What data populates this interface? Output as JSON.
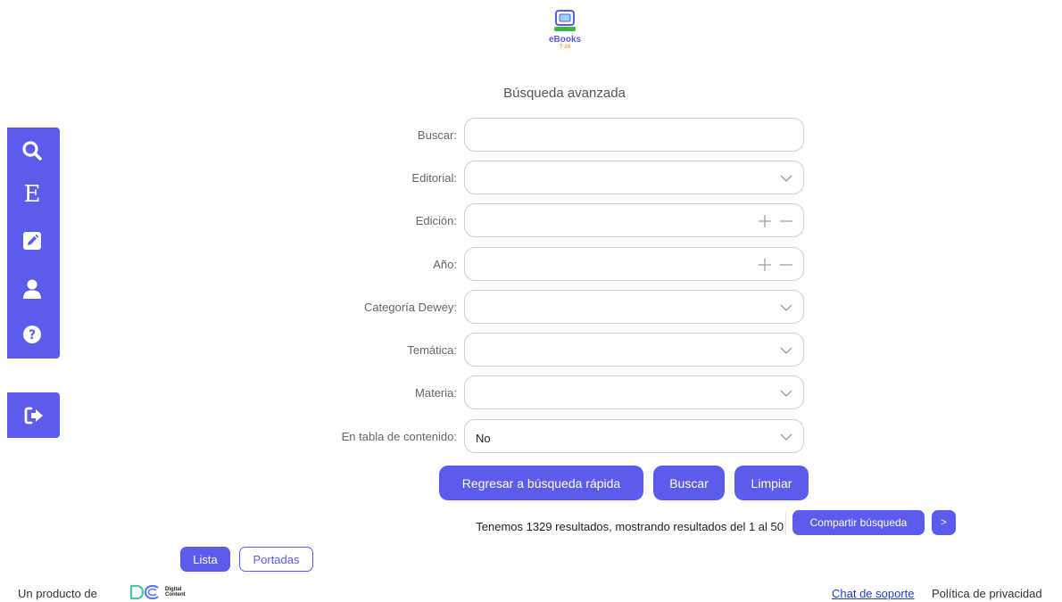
{
  "logo": {
    "text": "eBooks",
    "sub": "7·24"
  },
  "page_title": "Búsqueda avanzada",
  "sidebar": [
    {
      "icon": "search-icon"
    },
    {
      "icon": "editorial-icon",
      "glyph": "E"
    },
    {
      "icon": "pencil-icon"
    },
    {
      "icon": "user-icon"
    },
    {
      "icon": "help-icon"
    }
  ],
  "logout": {
    "icon": "logout-icon"
  },
  "form": {
    "buscar": {
      "label": "Buscar:",
      "value": ""
    },
    "editorial": {
      "label": "Editorial:",
      "value": ""
    },
    "edicion": {
      "label": "Edición:",
      "value": ""
    },
    "anio": {
      "label": "Año:",
      "value": ""
    },
    "dewey": {
      "label": "Categoría Dewey:",
      "value": ""
    },
    "tematica": {
      "label": "Temática:",
      "value": ""
    },
    "materia": {
      "label": "Materia:",
      "value": ""
    },
    "tabla": {
      "label": "En tabla de contenido:",
      "value": "No"
    }
  },
  "buttons": {
    "regresar": "Regresar a búsqueda rápida",
    "buscar": "Buscar",
    "limpiar": "Limpiar"
  },
  "results": {
    "text": "Tenemos 1329 resultados, mostrando resultados del 1 al 50",
    "share": "Compartir búsqueda",
    "next": ">"
  },
  "view": {
    "lista": "Lista",
    "portadas": "Portadas",
    "selected": "Lista"
  },
  "footer": {
    "producto": "Un producto de",
    "dc_logo_text": "Digital Content",
    "chat": "Chat de soporte",
    "privacidad": "Política de privacidad"
  },
  "colors": {
    "accent": "#5b5bec",
    "link": "#1f3fd6",
    "border": "#cfcfcf"
  }
}
